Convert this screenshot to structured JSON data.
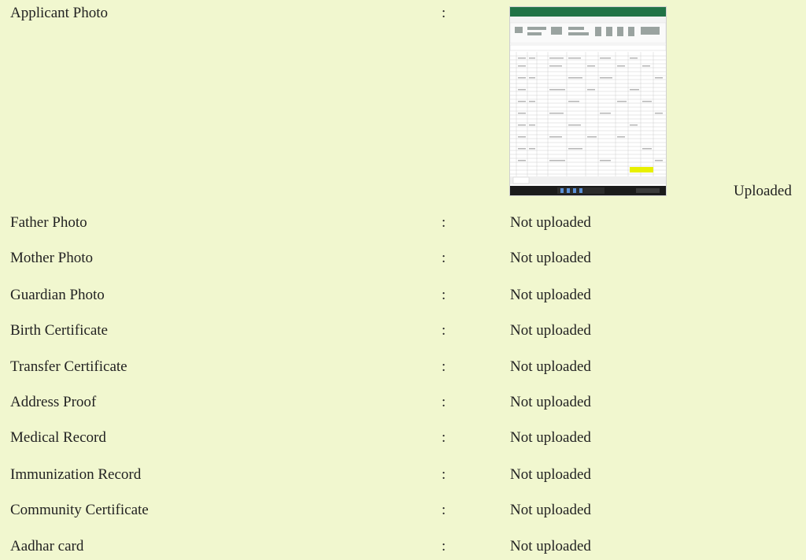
{
  "documents": [
    {
      "label": "Applicant Photo",
      "separator": ":",
      "status": "Uploaded",
      "thumbnail": "spreadsheet-screenshot-thumbnail"
    },
    {
      "label": "Father Photo",
      "separator": ":",
      "status": "Not uploaded"
    },
    {
      "label": "Mother Photo",
      "separator": ":",
      "status": "Not uploaded"
    },
    {
      "label": "Guardian Photo",
      "separator": ":",
      "status": "Not uploaded"
    },
    {
      "label": "Birth Certificate",
      "separator": ":",
      "status": "Not uploaded"
    },
    {
      "label": "Transfer Certificate",
      "separator": ":",
      "status": "Not uploaded"
    },
    {
      "label": "Address Proof",
      "separator": ":",
      "status": "Not uploaded"
    },
    {
      "label": "Medical Record",
      "separator": ":",
      "status": "Not uploaded"
    },
    {
      "label": "Immunization Record",
      "separator": ":",
      "status": "Not uploaded"
    },
    {
      "label": "Community Certificate",
      "separator": ":",
      "status": "Not uploaded"
    },
    {
      "label": "Aadhar card",
      "separator": ":",
      "status": "Not uploaded"
    }
  ],
  "colors": {
    "page_background": "#f1f7cf",
    "text": "#222222",
    "thumbnail_titlebar": "#217346",
    "thumbnail_taskbar": "#1b1b1b",
    "thumbnail_highlight": "#e8f000"
  }
}
